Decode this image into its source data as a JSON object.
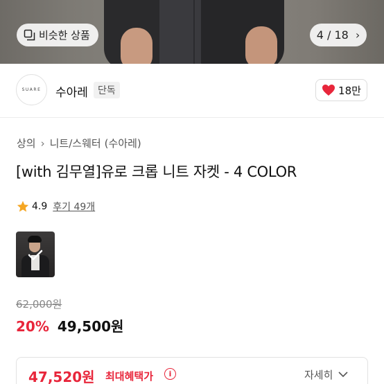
{
  "hero": {
    "similar_label": "비슷한 상품",
    "counter": "4 / 18"
  },
  "brand": {
    "logo_text": "SUARE",
    "name": "수아레",
    "tag": "단독",
    "likes": "18만"
  },
  "breadcrumb": [
    "상의",
    "니트/스웨터",
    "(수아레)"
  ],
  "product": {
    "title": "[with 김무열]유로 크롭 니트 자켓 - 4 COLOR",
    "rating": "4.9",
    "reviews": "후기 49개"
  },
  "price": {
    "original": "62,000원",
    "discount": "20%",
    "sale": "49,500원"
  },
  "benefit": {
    "price": "47,520원",
    "label": "최대혜택가",
    "info_icon": "i",
    "detail_label": "자세히"
  },
  "colors": {
    "accent_red": "#e8263b",
    "star": "#f5a623"
  }
}
